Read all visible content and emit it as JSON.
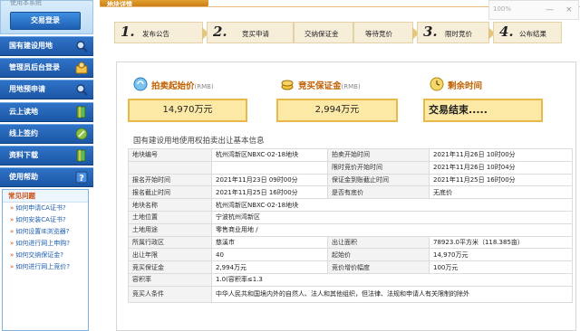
{
  "sidebar": {
    "top_text": "使用本系统",
    "login_button": "交易登录",
    "menu": [
      {
        "label": "国有建设用地",
        "icon": "search-icon",
        "color": "#3a7bd5"
      },
      {
        "label": "管理员后台登录",
        "icon": "admin-icon",
        "color": "#e6a23c"
      },
      {
        "label": "用地预申请",
        "icon": "search-icon",
        "color": "#3a7bd5"
      },
      {
        "label": "云上读地",
        "icon": "book-icon",
        "color": "#4caf50"
      },
      {
        "label": "线上签约",
        "icon": "pen-icon",
        "color": "#8bc34a"
      },
      {
        "label": "资料下载",
        "icon": "book-icon",
        "color": "#4caf50"
      },
      {
        "label": "使用帮助",
        "icon": "help-icon",
        "color": "#3a7bd5"
      }
    ],
    "help": {
      "title": "常见问题",
      "links": [
        "如何申请CA证书?",
        "如何安装CA证书?",
        "如何设置IE浏览器?",
        "如何进行网上申购?",
        "如何交纳保证金?",
        "如何进行网上竞价?"
      ]
    }
  },
  "top_tab": "地块详情",
  "window": {
    "zoom": "100%",
    "minimize": "—",
    "close": "×"
  },
  "steps": [
    {
      "num": "1.",
      "label": "发布公告"
    },
    {
      "num": "2.",
      "label": "竞买申请"
    },
    {
      "num": "",
      "label": "交纳保证金"
    },
    {
      "num": "",
      "label": "等待竞价"
    },
    {
      "num": "3.",
      "label": "限时竞价"
    },
    {
      "num": "4.",
      "label": "公布结果"
    }
  ],
  "highlights": {
    "start_price": {
      "label": "拍卖起始价",
      "unit": "(RMB)",
      "value": "14,970万元"
    },
    "deposit": {
      "label": "竞买保证金",
      "unit": "(RMB)",
      "value": "2,994万元"
    },
    "remaining": {
      "label": "剩余时间",
      "value": "交易结束....."
    }
  },
  "section_title": "国有建设用地使用权拍卖出让基本信息",
  "table": {
    "r1": {
      "k1": "地块编号",
      "v1": "杭州湾新区NBXC-02-18地块",
      "k2": "拍卖开始时间",
      "v2": "2021年11月26日 10时00分"
    },
    "r2": {
      "k2": "限时竞价开始时间",
      "v2": "2021年11月26日 10时04分"
    },
    "r3": {
      "k1": "报名开始时间",
      "v1": "2021年11月23日 09时00分",
      "k2": "保证金到账截止时间",
      "v2": "2021年11月25日 16时00分"
    },
    "r4": {
      "k1": "报名截止时间",
      "v1": "2021年11月25日 16时00分",
      "k2": "是否有底价",
      "v2": "无底价"
    },
    "r5": {
      "k1": "地块名称",
      "v1": "杭州湾新区NBXC-02-18地块"
    },
    "r6": {
      "k1": "土地位置",
      "v1": "宁波杭州湾新区"
    },
    "r7": {
      "k1": "土地用途",
      "v1": "零售商业用地 /"
    },
    "r8": {
      "k1": "所属行政区",
      "v1": "慈溪市",
      "k2": "出让面积",
      "v2": "78923.0平方米（118.385亩）"
    },
    "r9": {
      "k1": "出让年限",
      "v1": "40",
      "k2": "起始价",
      "v2": "14,970万元"
    },
    "r10": {
      "k1": "竞买保证金",
      "v1": "2,994万元",
      "k2": "竞价增价幅度",
      "v2": "100万元"
    },
    "r11": {
      "k1": "容积率",
      "v1": "1.0(容积率≤1.3"
    },
    "r12": {
      "k1": "竞买人条件",
      "v1": "中华人民共和国境内外的自然人、法人和其他组织，但法律、法规和申请人有关限制的除外"
    }
  }
}
